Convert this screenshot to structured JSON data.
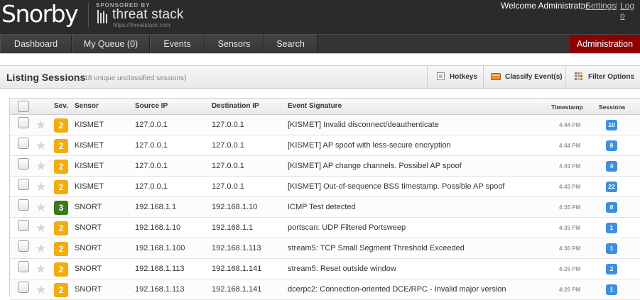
{
  "header": {
    "app_name": "Snorby",
    "sponsor_label": "SPONSORED BY",
    "sponsor_name": "threat stack",
    "sponsor_url": "https://threatstack.com",
    "welcome": "Welcome Administrator",
    "settings_link": "Settings",
    "separator": "|",
    "logout_link": "Log o"
  },
  "nav": {
    "items": [
      {
        "label": "Dashboard"
      },
      {
        "label": "My Queue (0)"
      },
      {
        "label": "Events"
      },
      {
        "label": "Sensors"
      },
      {
        "label": "Search"
      }
    ],
    "admin": "Administration"
  },
  "toolbar": {
    "title": "Listing Sessions",
    "subtitle": "(18 unique unclassified sessions)",
    "hotkeys": "Hotkeys",
    "classify": "Classify Event(s)",
    "filter": "Filter Options"
  },
  "table": {
    "columns": {
      "sev": "Sev.",
      "sensor": "Sensor",
      "source": "Source IP",
      "dest": "Destination IP",
      "signature": "Event Signature",
      "timestamp": "Timestamp",
      "sessions": "Sessions"
    },
    "rows": [
      {
        "sev": "2",
        "sensor": "KISMET",
        "src": "127.0.0.1",
        "dst": "127.0.0.1",
        "sig": "[KISMET] Invalid disconnect/deauthenticate",
        "ts": "4:44 PM",
        "sessions": "10"
      },
      {
        "sev": "2",
        "sensor": "KISMET",
        "src": "127.0.0.1",
        "dst": "127.0.0.1",
        "sig": "[KISMET] AP spoof with less-secure encryption",
        "ts": "4:44 PM",
        "sessions": "8"
      },
      {
        "sev": "2",
        "sensor": "KISMET",
        "src": "127.0.0.1",
        "dst": "127.0.0.1",
        "sig": "[KISMET] AP change channels. Possibel AP spoof",
        "ts": "4:43 PM",
        "sessions": "4"
      },
      {
        "sev": "2",
        "sensor": "KISMET",
        "src": "127.0.0.1",
        "dst": "127.0.0.1",
        "sig": "[KISMET] Out-of-sequence BSS timestamp. Possible AP spoof",
        "ts": "4:43 PM",
        "sessions": "22"
      },
      {
        "sev": "3",
        "sensor": "SNORT",
        "src": "192.168.1.1",
        "dst": "192.168.1.10",
        "sig": "ICMP Test detected",
        "ts": "4:35 PM",
        "sessions": "8"
      },
      {
        "sev": "2",
        "sensor": "SNORT",
        "src": "192.168.1.10",
        "dst": "192.168.1.1",
        "sig": "portscan: UDP Filtered Portsweep",
        "ts": "4:35 PM",
        "sessions": "1"
      },
      {
        "sev": "2",
        "sensor": "SNORT",
        "src": "192.168.1.100",
        "dst": "192.168.1.113",
        "sig": "stream5: TCP Small Segment Threshold Exceeded",
        "ts": "4:30 PM",
        "sessions": "1"
      },
      {
        "sev": "2",
        "sensor": "SNORT",
        "src": "192.168.1.113",
        "dst": "192.168.1.141",
        "sig": "stream5: Reset outside window",
        "ts": "4:26 PM",
        "sessions": "2"
      },
      {
        "sev": "2",
        "sensor": "SNORT",
        "src": "192.168.1.113",
        "dst": "192.168.1.141",
        "sig": "dcerpc2: Connection-oriented DCE/RPC - Invalid major version",
        "ts": "4:26 PM",
        "sessions": "1"
      }
    ]
  },
  "colors": {
    "sev2": "#f2ac0b",
    "sev3": "#3b7a1f",
    "admin": "#8e0000",
    "badge": "#3d8fe0"
  }
}
